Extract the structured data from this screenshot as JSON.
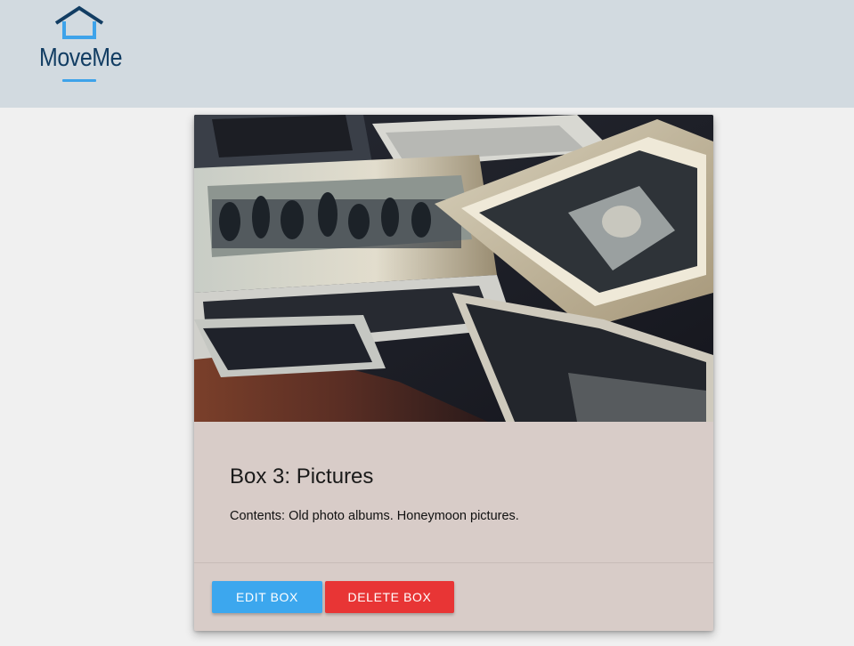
{
  "header": {
    "logo_text": "MoveMe",
    "background": "#d2dae0",
    "logo_color": "#123d63",
    "logo_accent": "#3ea3ea"
  },
  "card": {
    "image_icon": "old-photographs-image",
    "title": "Box 3: Pictures",
    "contents": "Contents: Old photo albums. Honeymoon pictures.",
    "background": "#d8ccc8",
    "actions": {
      "edit_label": "EDIT BOX",
      "delete_label": "DELETE BOX",
      "edit_color": "#3ca7ee",
      "delete_color": "#e83535"
    }
  }
}
